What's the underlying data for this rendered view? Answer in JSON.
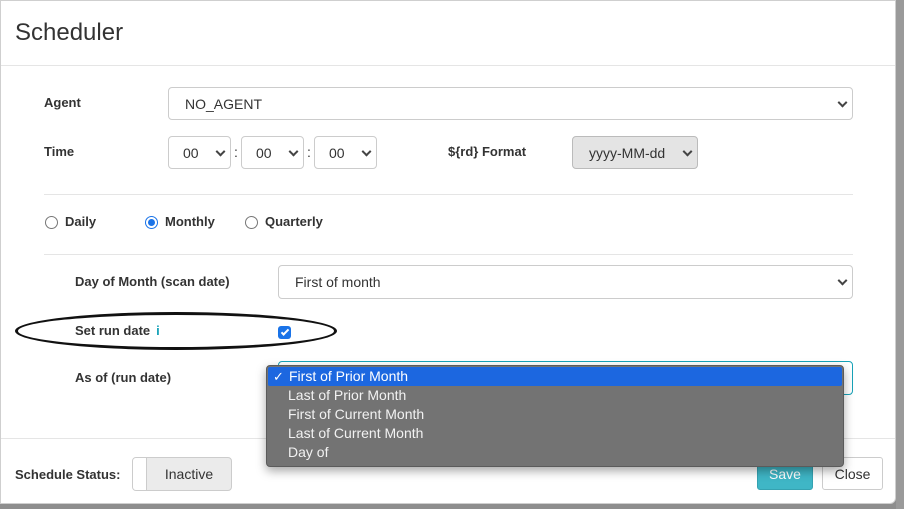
{
  "modal": {
    "title": "Scheduler"
  },
  "agent": {
    "label": "Agent",
    "value": "NO_AGENT"
  },
  "time": {
    "label": "Time",
    "hours": "00",
    "minutes": "00",
    "seconds": "00",
    "separator": ":"
  },
  "rd_format": {
    "label": "${rd} Format",
    "value": "yyyy-MM-dd"
  },
  "frequency": {
    "options": [
      {
        "label": "Daily",
        "checked": false
      },
      {
        "label": "Monthly",
        "checked": true
      },
      {
        "label": "Quarterly",
        "checked": false
      }
    ]
  },
  "day_of_month": {
    "label": "Day of Month (scan date)",
    "value": "First of month"
  },
  "set_run_date": {
    "label": "Set run date",
    "info_icon": "i",
    "checked": true
  },
  "as_of": {
    "label": "As of (run date)",
    "options": [
      "First of Prior Month",
      "Last of Prior Month",
      "First of Current Month",
      "Last of Current Month",
      "Day of"
    ],
    "selected": "First of Prior Month",
    "check_mark": "✓"
  },
  "footer": {
    "status_label": "Schedule Status:",
    "status_value": "Inactive",
    "save_label": "Save",
    "close_label": "Close"
  },
  "colors": {
    "accent": "#17a2b8",
    "save": "#3fb6c6",
    "selected_option": "#1c67e0",
    "radio": "#1a73e8"
  }
}
